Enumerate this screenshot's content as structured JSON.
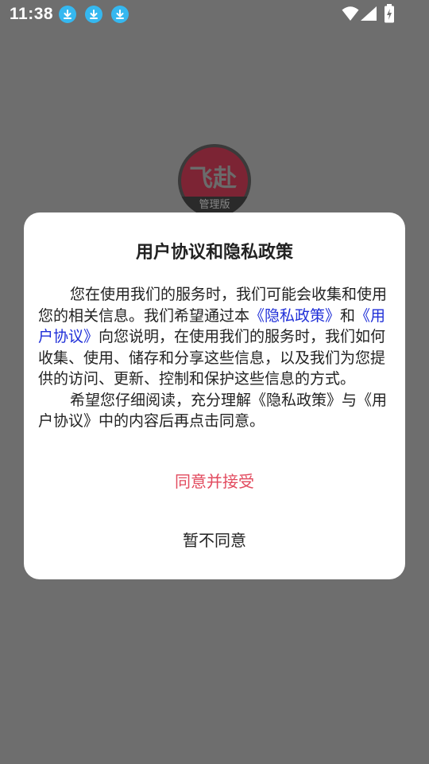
{
  "status_bar": {
    "time": "11:38",
    "notification_icons": [
      "download-icon",
      "download-icon",
      "download-icon"
    ],
    "right_icons": [
      "wifi-icon",
      "signal-icon",
      "battery-charging-icon"
    ],
    "accent_color": "#35b8f0"
  },
  "app": {
    "logo_text": "飞赴",
    "logo_subtitle": "管理版"
  },
  "dialog": {
    "title": "用户协议和隐私政策",
    "paragraph1": {
      "text_before": "您在使用我们的服务时，我们可能会收集和使用您的相关信息。我们希望通过本",
      "link_privacy": "《隐私政策》",
      "and": "和",
      "link_user": "《用户协议》",
      "text_after": "向您说明，在使用我们的服务时，我们如何收集、使用、储存和分享这些信息，以及我们为您提供的访问、更新、控制和保护这些信息的方式。"
    },
    "paragraph2": "希望您仔细阅读，充分理解《隐私政策》与《用户协议》中的内容后再点击同意。",
    "accept_label": "同意并接受",
    "decline_label": "暂不同意",
    "accept_color": "#e24a5e",
    "link_color": "#1f2fd8"
  }
}
